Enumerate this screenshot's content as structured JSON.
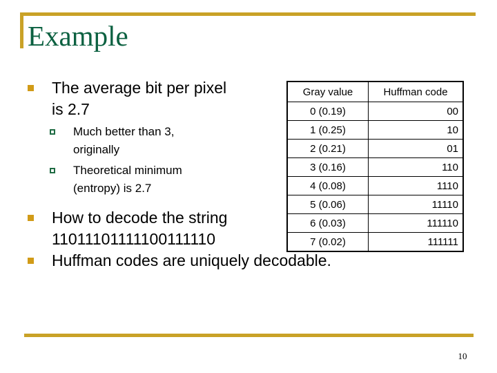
{
  "slide": {
    "title": "Example",
    "page_number": "10",
    "accent_gold": "#c9a227",
    "title_green": "#0c6141",
    "bullet_gold": "#d19b17",
    "subbullet_green": "#1f6b43"
  },
  "body": {
    "bullet1": {
      "line1": "The average bit per pixel",
      "line2": "is 2.7"
    },
    "sub1": {
      "line1": "Much better than 3,",
      "line2": "originally"
    },
    "sub2": {
      "line1": "Theoretical minimum",
      "line2": "(entropy) is 2.7"
    },
    "bullet2": {
      "line1": "How to decode the string",
      "line2": "11011101111100111110"
    },
    "bullet3": {
      "line1": "Huffman codes are uniquely decodable."
    }
  },
  "table": {
    "headers": [
      "Gray value",
      "Huffman code"
    ],
    "rows": [
      {
        "gray": "0  (0.19)",
        "code": "00"
      },
      {
        "gray": "1 (0.25)",
        "code": "10"
      },
      {
        "gray": "2 (0.21)",
        "code": "01"
      },
      {
        "gray": "3 (0.16)",
        "code": "110"
      },
      {
        "gray": "4 (0.08)",
        "code": "1110"
      },
      {
        "gray": "5 (0.06)",
        "code": "11110"
      },
      {
        "gray": "6 (0.03)",
        "code": "111110"
      },
      {
        "gray": "7 (0.02)",
        "code": "111111"
      }
    ]
  }
}
